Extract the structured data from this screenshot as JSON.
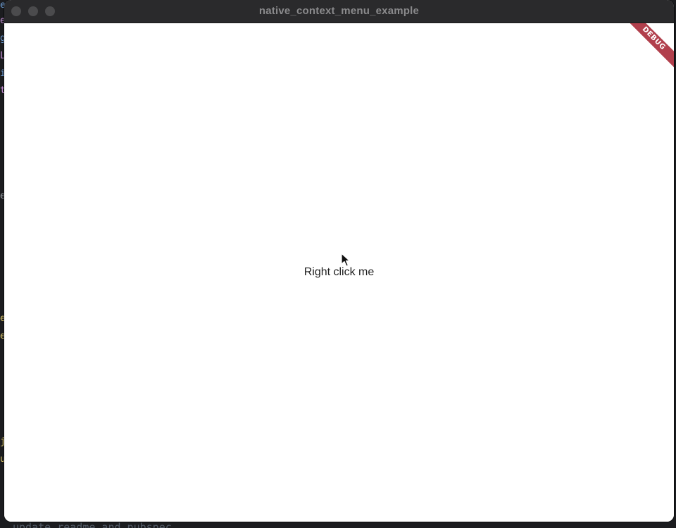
{
  "window": {
    "title": "native_context_menu_example"
  },
  "content": {
    "label": "Right click me"
  },
  "debug_banner": {
    "text": "DEBUG",
    "color": "#b13f4c"
  },
  "background": {
    "edge_chars": [
      "e",
      "e",
      "g",
      "L",
      "i",
      "t",
      "e",
      "e",
      "e",
      "j",
      "u"
    ],
    "bottom_text": "update_readme_and_pubspec"
  }
}
